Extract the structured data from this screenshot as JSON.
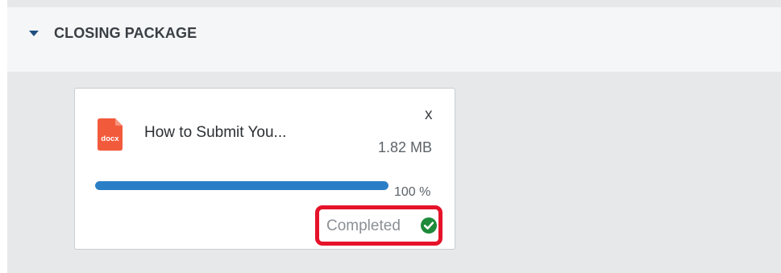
{
  "section": {
    "title": "CLOSING PACKAGE",
    "collapse_icon": "caret-down-icon"
  },
  "upload_card": {
    "file_type_badge": "docx",
    "file_icon": "docx-file-icon",
    "file_name": "How to Submit You...",
    "close_label": "x",
    "file_size": "1.82 MB",
    "progress_percent": 100,
    "progress_label": "100 %",
    "status_text": "Completed",
    "status_icon": "check-circle-icon",
    "colors": {
      "progress": "#2a7ec6",
      "status_ok": "#1e8a3a",
      "highlight": "#e5122a",
      "file_icon": "#f25a3c"
    }
  }
}
